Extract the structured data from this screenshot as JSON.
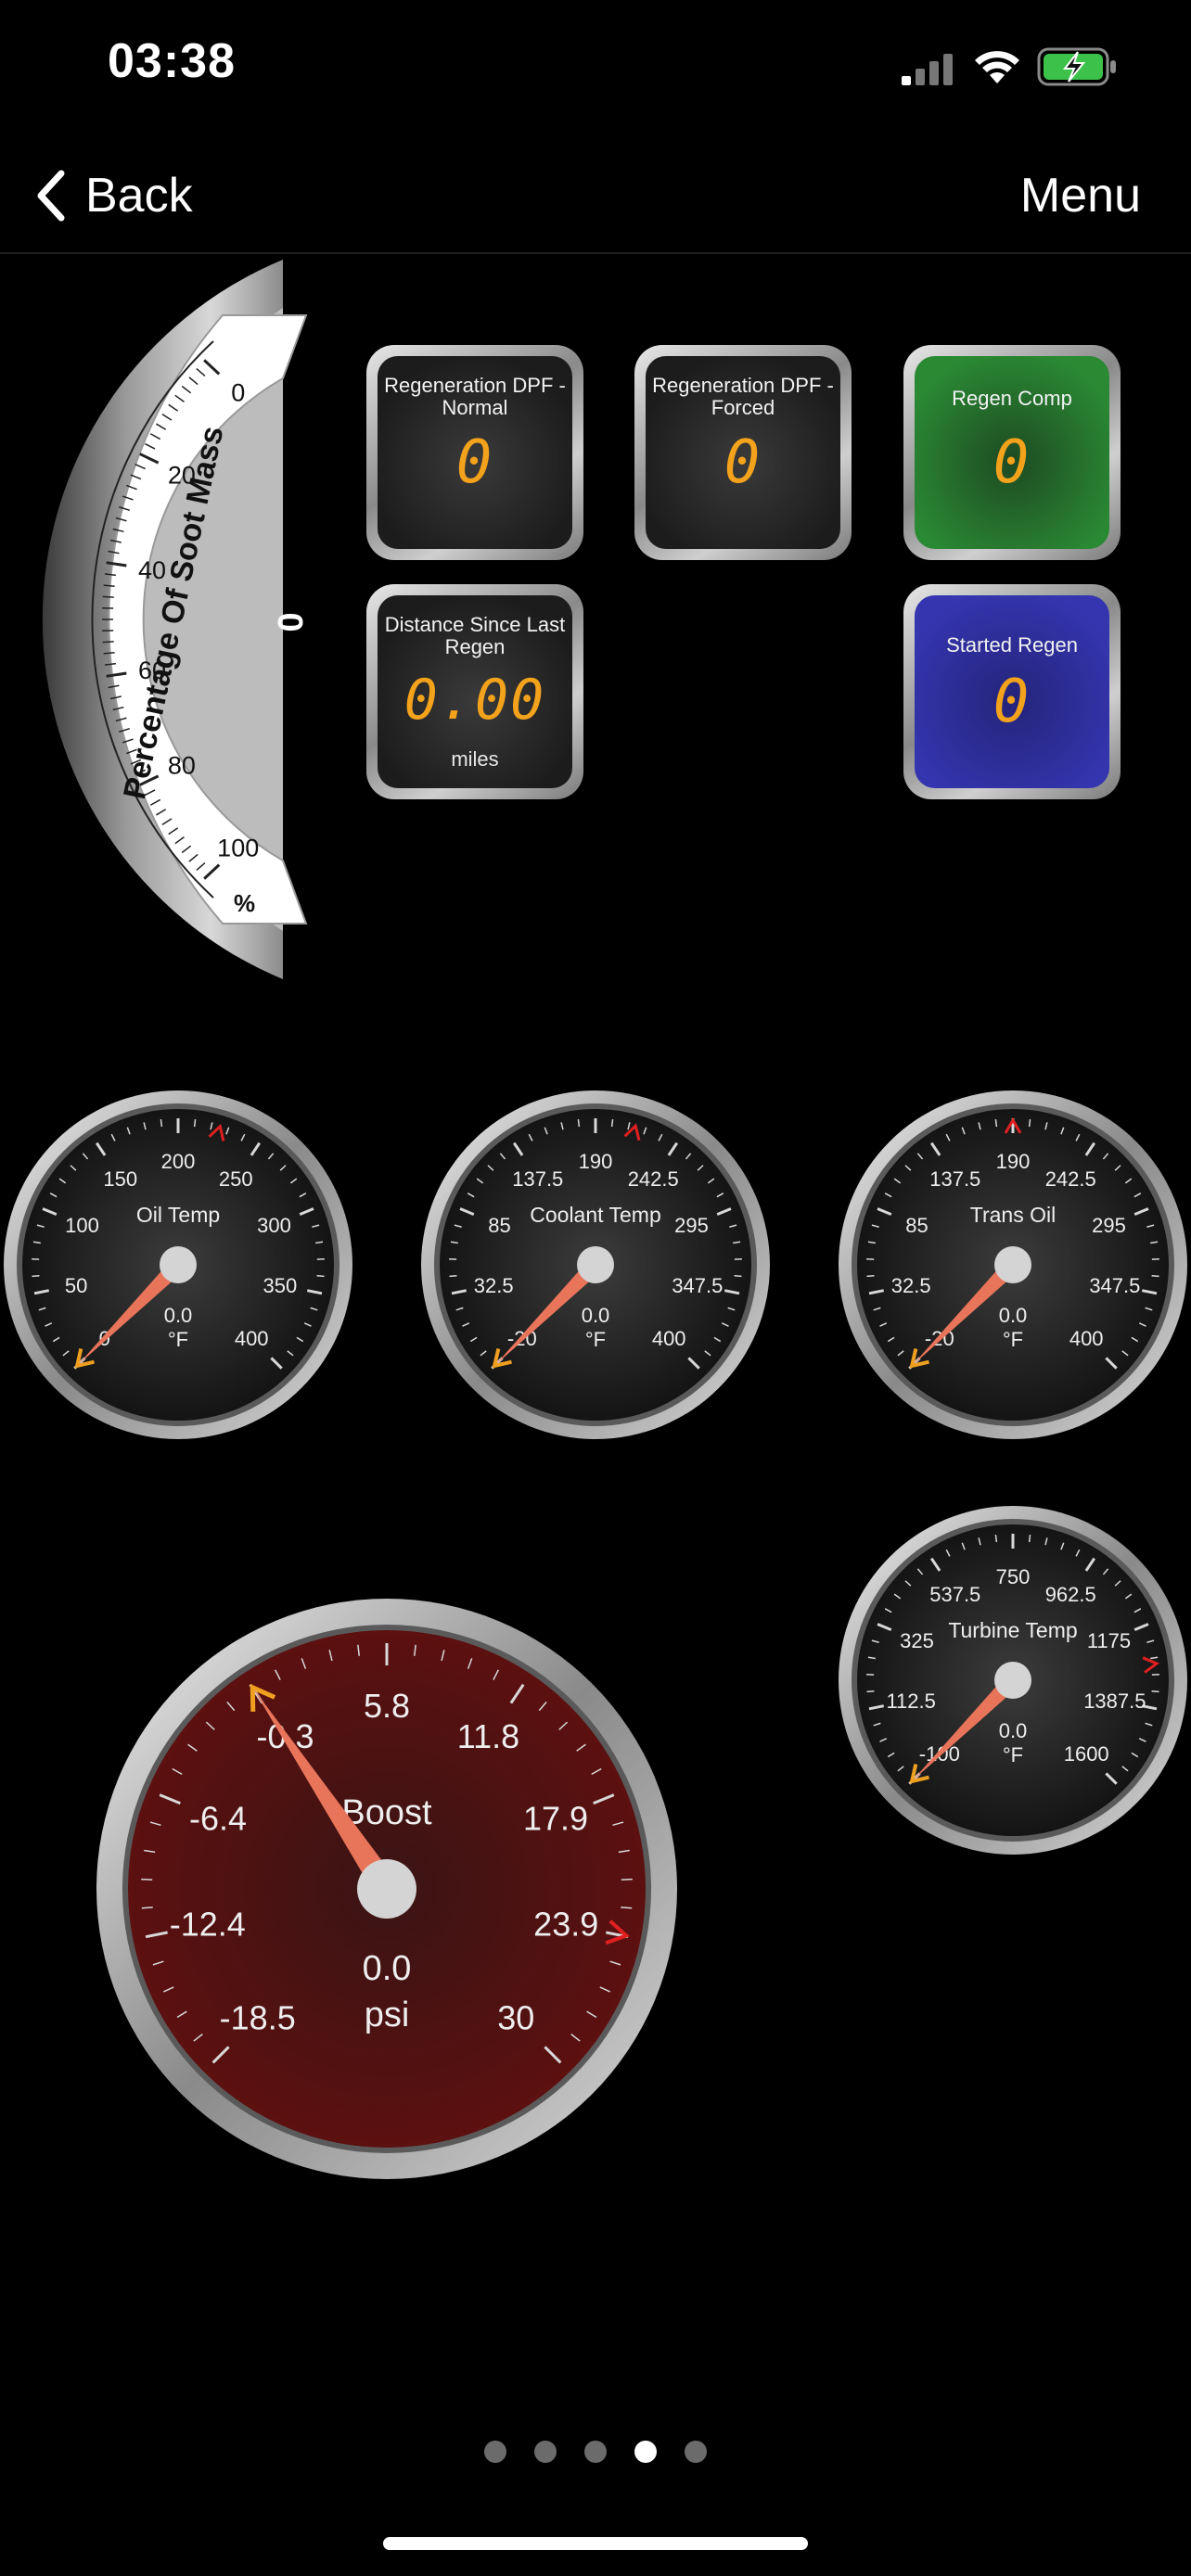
{
  "status": {
    "time": "03:38"
  },
  "nav": {
    "back_label": "Back",
    "menu_label": "Menu"
  },
  "soot_gauge": {
    "title": "Percentage Of Soot Mass",
    "ticks": [
      "0",
      "20",
      "40",
      "60",
      "80",
      "100"
    ],
    "unit": "%",
    "value_display": "0",
    "value": 0,
    "range": [
      0,
      100
    ]
  },
  "tiles": [
    {
      "title": "Regeneration DPF - Normal",
      "value": "0",
      "unit": "",
      "bg": "#262626"
    },
    {
      "title": "Regeneration DPF - Forced",
      "value": "0",
      "unit": "",
      "bg": "#262626"
    },
    {
      "title": "Regen Comp",
      "value": "0",
      "unit": "",
      "bg": "#1f6a28"
    },
    {
      "title": "Distance Since Last Regen",
      "value": "0.00",
      "unit": "miles",
      "bg": "#262626"
    },
    {
      "title": "Started Regen",
      "value": "0",
      "unit": "",
      "bg": "#2d2d9a"
    }
  ],
  "gauges": [
    {
      "title": "Oil Temp",
      "ticks": [
        "0",
        "50",
        "100",
        "150",
        "200",
        "250",
        "300",
        "350",
        "400"
      ],
      "value_display": "0.0",
      "unit": "°F",
      "value": 0,
      "range": [
        0,
        400
      ],
      "redline": 225
    },
    {
      "title": "Coolant Temp",
      "ticks": [
        "-20",
        "32.5",
        "85",
        "137.5",
        "190",
        "242.5",
        "295",
        "347.5",
        "400"
      ],
      "value_display": "0.0",
      "unit": "°F",
      "value": -20,
      "range": [
        -20,
        400
      ],
      "redline": 215
    },
    {
      "title": "Trans Oil",
      "ticks": [
        "-20",
        "32.5",
        "85",
        "137.5",
        "190",
        "242.5",
        "295",
        "347.5",
        "400"
      ],
      "value_display": "0.0",
      "unit": "°F",
      "value": -20,
      "range": [
        -20,
        400
      ],
      "redline": 190
    },
    {
      "title": "Turbine Temp",
      "ticks": [
        "-100",
        "112.5",
        "325",
        "537.5",
        "750",
        "962.5",
        "1175",
        "1387.5",
        "1600"
      ],
      "value_display": "0.0",
      "unit": "°F",
      "value": -100,
      "range": [
        -100,
        1600
      ],
      "redline": 1275
    },
    {
      "title": "Boost",
      "ticks": [
        "-18.5",
        "-12.4",
        "-6.4",
        "-0.3",
        "5.8",
        "11.8",
        "17.9",
        "23.9",
        "30"
      ],
      "value_display": "0.0",
      "unit": "psi",
      "value": -0.3,
      "range": [
        -18.5,
        30
      ],
      "redline": 23.9
    }
  ],
  "page_dots": {
    "count": 5,
    "active": 3
  },
  "colors": {
    "needle": "#e8755a",
    "needle_marker": "#f0a020",
    "redline": "#e02020",
    "segment": "#f3a21c"
  }
}
